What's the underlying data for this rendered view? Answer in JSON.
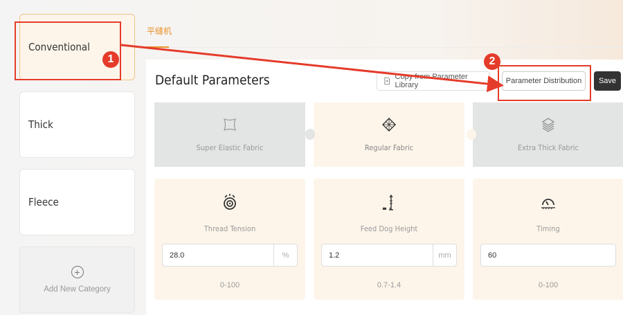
{
  "sidebar": {
    "categories": [
      {
        "label": "Conventional"
      },
      {
        "label": "Thick"
      },
      {
        "label": "Fleece"
      }
    ],
    "add_label": "Add New Category"
  },
  "tabs": [
    {
      "label": "平缝机"
    }
  ],
  "panel": {
    "title": "Default Parameters",
    "copy_button": "Copy from Parameter Library",
    "distribution_button": "Parameter Distribution",
    "save_button": "Save"
  },
  "fabrics": [
    {
      "label": "Super Elastic Fabric",
      "icon": "stretch-fabric-icon"
    },
    {
      "label": "Regular Fabric",
      "icon": "fabric-icon"
    },
    {
      "label": "Extra Thick Fabric",
      "icon": "layered-fabric-icon"
    }
  ],
  "params": [
    {
      "label": "Thread Tension",
      "value": "28.0",
      "unit": "%",
      "range": "0-100",
      "icon": "thread-tension-icon"
    },
    {
      "label": "Feed Dog Height",
      "value": "1.2",
      "unit": "mm",
      "range": "0.7-1.4",
      "icon": "feed-dog-height-icon"
    },
    {
      "label": "Timing",
      "value": "60",
      "unit": "",
      "range": "0-100",
      "icon": "timing-gauge-icon"
    }
  ],
  "annotations": [
    "1",
    "2"
  ],
  "colors": {
    "accent": "#e8912a",
    "annotation": "#e53b2a",
    "save_bg": "#333333"
  }
}
